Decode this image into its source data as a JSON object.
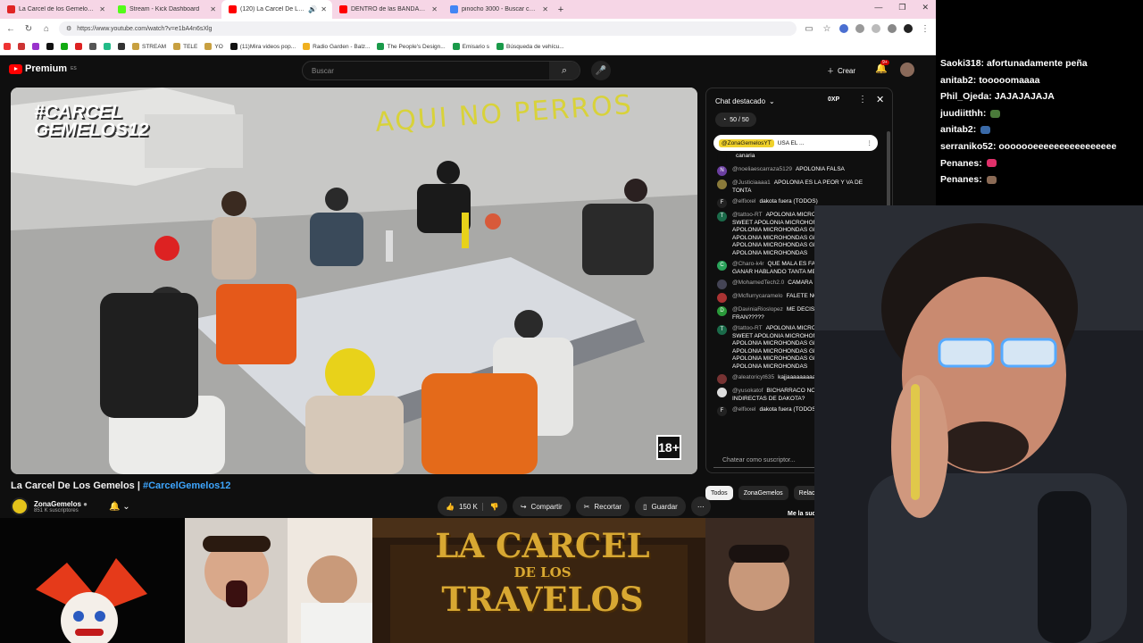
{
  "browser": {
    "tabs": [
      {
        "label": "La Carcel de los Gemelos | Vota",
        "color": "#e02424",
        "active": false
      },
      {
        "label": "Stream - Kick Dashboard",
        "color": "#53fc18",
        "active": false
      },
      {
        "label": "(120) La Carcel De Los Geme",
        "color": "#ff0000",
        "active": true
      },
      {
        "label": "DENTRO de las BANDAS JUVENI",
        "color": "#ff0000",
        "active": false
      },
      {
        "label": "pinocho 3000 - Buscar con Goo",
        "color": "#4285f4",
        "active": false
      }
    ],
    "new_tab": "+",
    "url": "https://www.youtube.com/watch?v=e1bA4n6sXlg",
    "bookmarks": [
      "STREAM",
      "TELE",
      "YO",
      "(11)Mira videos pop...",
      "Radio Garden - Balz...",
      "The People's Design...",
      "Emisario s",
      "Búsqueda de vehícu..."
    ]
  },
  "youtube": {
    "logo": "Premium",
    "logo_region": "ES",
    "search_placeholder": "Buscar",
    "create_label": "Crear",
    "notif_badge": "9+",
    "video_overlay_logo": "#CARCEL GEMELOS12",
    "video_graffiti": "AQUI NO PERROS",
    "rating": "18+",
    "title": "La Carcel De Los Gemelos | ",
    "title_tag": "#CarcelGemelos12",
    "channel_name": "ZonaGemelos",
    "channel_subs": "851 K suscriptores",
    "actions": {
      "likes": "150 K",
      "share": "Compartir",
      "clip": "Recortar",
      "save": "Guardar"
    },
    "chat": {
      "title": "Chat destacado",
      "xp": "0XP",
      "count": "50 / 50",
      "pinned_author": "@ZonaGemelosYT",
      "pinned_text": "USA EL ...",
      "input_placeholder": "Chatear como suscriptor...",
      "messages": [
        {
          "author": "",
          "text": "canaria",
          "avatar": "#0f0f0f",
          "initial": ""
        },
        {
          "author": "@noeliaescarraza5129",
          "text": "APOLONIA FALSA",
          "avatar": "#6b3fa0",
          "initial": "N"
        },
        {
          "author": "@Justiciaaaa1",
          "text": "APOLONIA ES LA PEOR Y VA DE TONTA",
          "avatar": "#8a7a3a",
          "initial": ""
        },
        {
          "author": "@elfixxel",
          "text": "dakota fuera (TODOS)",
          "avatar": "#222",
          "initial": "F"
        },
        {
          "author": "@tattoo-RT",
          "text": "APOLONIA MICROHONDAS GRANDE SWEET APOLONIA MICROHONDAS GRANDE SWEET APOLONIA MICROHONDAS GRANDE SWEET APOLONIA MICROHONDAS GRANDE SWEET APOLONIA MICROHONDAS GRANDE SWEET APOLONIA MICROHONDAS",
          "avatar": "#1b6b4a",
          "initial": "T"
        },
        {
          "author": "@Charo-k4r",
          "text": "QUE MALA ES FALETE NO PUEDE GANAR HABLANDO TANTA MENTIRA 😩😩😩😩😩",
          "avatar": "#2aa35a",
          "initial": "C"
        },
        {
          "author": "@MohamedTech2.0",
          "text": "CAMARA DANIELAAA",
          "avatar": "#445",
          "initial": ""
        },
        {
          "author": "@Mcflurrycaramelo",
          "text": "FALETE NO ES FALSA PERROS",
          "avatar": "#a33",
          "initial": ""
        },
        {
          "author": "@DaviniaRioslopez",
          "text": "ME DECIS DONDE ESTA FRAN?????",
          "avatar": "#2a9a3a",
          "initial": "D"
        },
        {
          "author": "@tattoo-RT",
          "text": "APOLONIA MICROHONDAS GRANDE SWEET APOLONIA MICROHONDAS GRANDE SWEET APOLONIA MICROHONDAS GRANDE SWEET APOLONIA MICROHONDAS GRANDE SWEET APOLONIA MICROHONDAS GRANDE SWEET APOLONIA MICROHONDAS",
          "avatar": "#1b6b4a",
          "initial": "T"
        },
        {
          "author": "@aleatoricyt635",
          "text": "kajjaaaaaaaaaaaaaaaaaaaaaaajaja",
          "avatar": "#733",
          "initial": ""
        },
        {
          "author": "@yusokatof",
          "text": "BICHARRACO NO CAPTA LAS INDIRECTAS DE DAKOTA?",
          "avatar": "#ddd",
          "initial": ""
        },
        {
          "author": "@elfixxel",
          "text": "dakota fuera (TODOS)",
          "avatar": "#222",
          "initial": "F"
        }
      ]
    },
    "related_tabs": [
      "Todos",
      "ZonaGemelos",
      "Relacionados"
    ],
    "related_title": "Me la sudas -"
  },
  "stream_chat": [
    {
      "user": "Saoki318",
      "text": "afortunadamente peña",
      "emote": ""
    },
    {
      "user": "anitab2",
      "text": "tooooomaaaa",
      "emote": ""
    },
    {
      "user": "Phil_Ojeda",
      "text": "JAJAJAJAJA",
      "emote": ""
    },
    {
      "user": "juudiitthh",
      "text": "",
      "emote": "#4a7a3a"
    },
    {
      "user": "anitab2",
      "text": "",
      "emote": "#3a6aa8"
    },
    {
      "user": "serraniko52",
      "text": "ooooooeeeeeeeeeeeeeeee",
      "emote": ""
    },
    {
      "user": "Penanes",
      "text": "",
      "emote": "#e0306a"
    },
    {
      "user": "Penanes",
      "text": "",
      "emote": "#8a6a55"
    }
  ],
  "bottom": {
    "travelos_line1": "LA CARCEL",
    "travelos_line2": "DE LOS",
    "travelos_line3": "TRAVELOS"
  }
}
